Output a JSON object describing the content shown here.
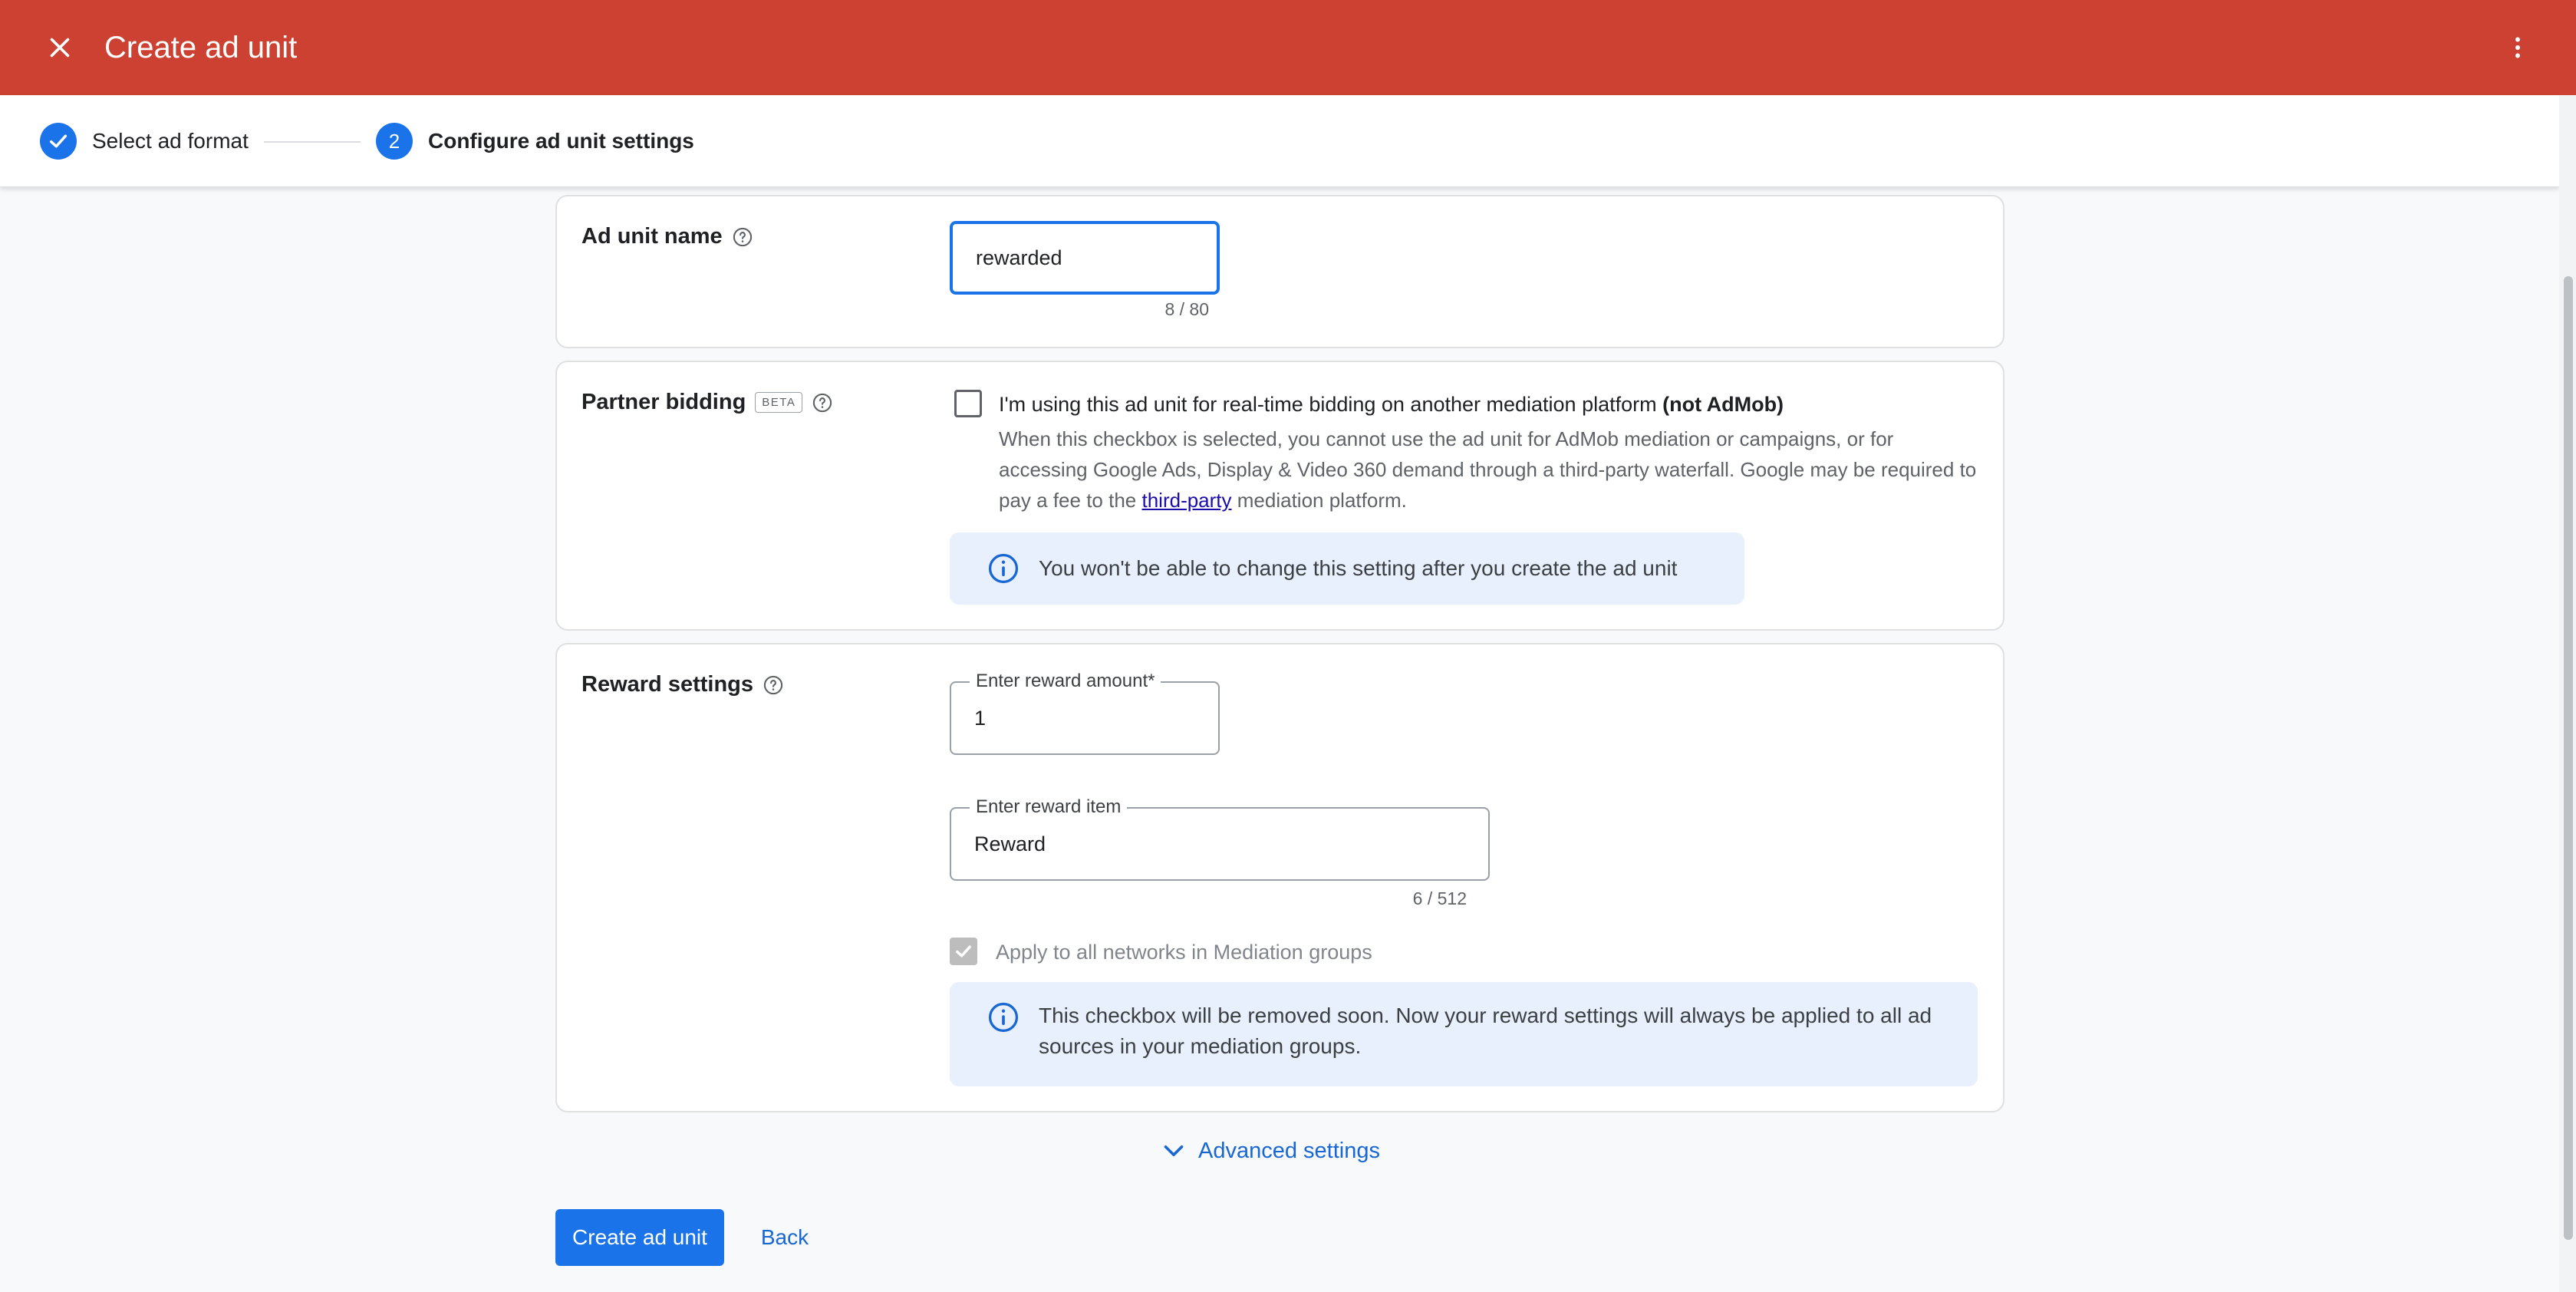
{
  "appbar": {
    "title": "Create ad unit",
    "close_icon": "close-icon",
    "more_icon": "more-vert-icon",
    "color": "#cc4131"
  },
  "stepper": {
    "steps": [
      {
        "label": "Select ad format",
        "state": "completed",
        "icon": "check-icon"
      },
      {
        "label": "Configure ad unit settings",
        "number": "2",
        "state": "active"
      }
    ]
  },
  "ad_unit_name": {
    "label": "Ad unit name",
    "value": "rewarded",
    "counter": "8 / 80"
  },
  "partner_bidding": {
    "label": "Partner bidding",
    "badge": "BETA",
    "checkbox_label": "I'm using this ad unit for real-time bidding on another mediation platform",
    "checkbox_label_bold": "(not AdMob)",
    "description_before_link": "When this checkbox is selected, you cannot use the ad unit for AdMob mediation or campaigns, or for accessing Google Ads, Display & Video 360 demand through a third-party waterfall. Google may be required to pay a fee to the",
    "link_text": "third-party",
    "description_after_link": "mediation platform.",
    "info": "You won't be able to change this setting after you create the ad unit",
    "checked": false
  },
  "reward_settings": {
    "label": "Reward settings",
    "amount_label": "Enter reward amount*",
    "amount_value": "1",
    "item_label": "Enter reward item",
    "item_value": "Reward",
    "item_counter": "6 / 512",
    "apply_label": "Apply to all networks in Mediation groups",
    "apply_checked": true,
    "info": "This checkbox will be removed soon. Now your reward settings will always be applied to all ad sources in your mediation groups."
  },
  "advanced": {
    "label": "Advanced settings"
  },
  "actions": {
    "create_label": "Create ad unit",
    "back_label": "Back"
  },
  "colors": {
    "primary": "#1a73e8",
    "info_bg": "#e8f0fe",
    "link": "#1967d2"
  }
}
